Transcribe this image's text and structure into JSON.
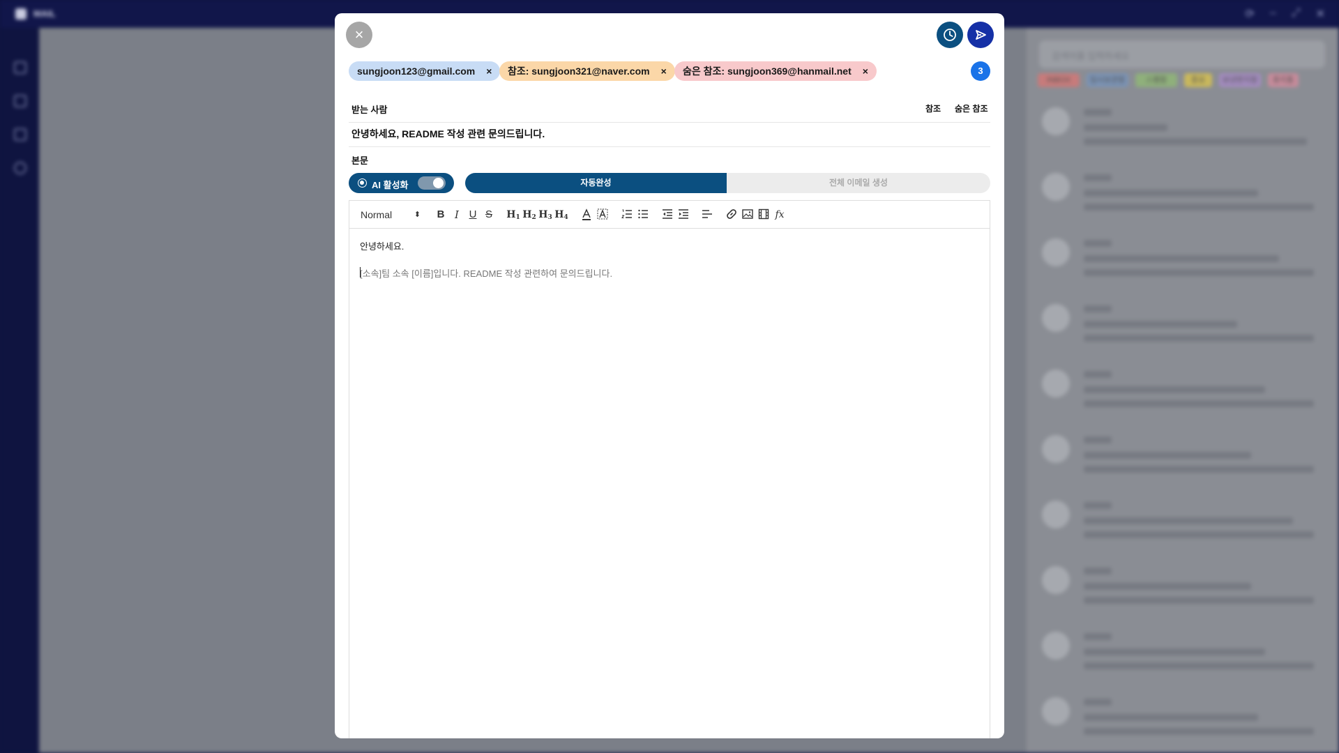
{
  "background": {
    "app_name": "MAIL",
    "search_placeholder": "검색어를 입력하세요",
    "tags": [
      "INBOX",
      "임시보관함",
      "스팸함",
      "중요",
      "보낸편지함",
      "휴지통"
    ],
    "tag_colors": [
      "#c77b7b",
      "#7b93b5",
      "#8fb07b",
      "#c9b85c",
      "#a38bbf",
      "#c78b9b"
    ]
  },
  "compose": {
    "recipients": {
      "to_chip": "sungjoon123@gmail.com",
      "cc_chip": "참조: sungjoon321@naver.com",
      "bcc_chip": "숨은 참조: sungjoon369@hanmail.net",
      "remove_symbol": "×",
      "count": "3",
      "to_label": "받는 사람",
      "cc_link": "참조",
      "bcc_link": "숨은 참조"
    },
    "subject": "안녕하세요, README 작성 관련 문의드립니다.",
    "body_label": "본문",
    "ai": {
      "label": "AI 활성화",
      "enabled": true
    },
    "modes": {
      "autocomplete": "자동완성",
      "full_generate": "전체 이메일 생성"
    },
    "toolbar": {
      "format": "Normal",
      "format_caret": "⬍",
      "bold": "B",
      "italic": "I",
      "underline": "U",
      "strike": "S",
      "h1": "H",
      "h2": "H",
      "h3": "H",
      "h4": "H",
      "h1_sub": "1",
      "h2_sub": "2",
      "h3_sub": "3",
      "h4_sub": "4",
      "formula": "fx"
    },
    "body": {
      "line1": "안녕하세요.",
      "line2": "[소속]팀 소속 [이름]입니다. README 작성 관련하여 문의드립니다."
    },
    "close_symbol": "×"
  },
  "colors": {
    "primary": "#0b4f80",
    "send": "#1530a6",
    "badge": "#1a73e8",
    "to_chip": "#c8dcf5",
    "cc_chip": "#fbd7a8",
    "bcc_chip": "#f8c9cb"
  },
  "icons": [
    "close-icon",
    "clock-icon",
    "send-icon",
    "link-icon",
    "image-icon",
    "video-icon",
    "formula-icon"
  ]
}
